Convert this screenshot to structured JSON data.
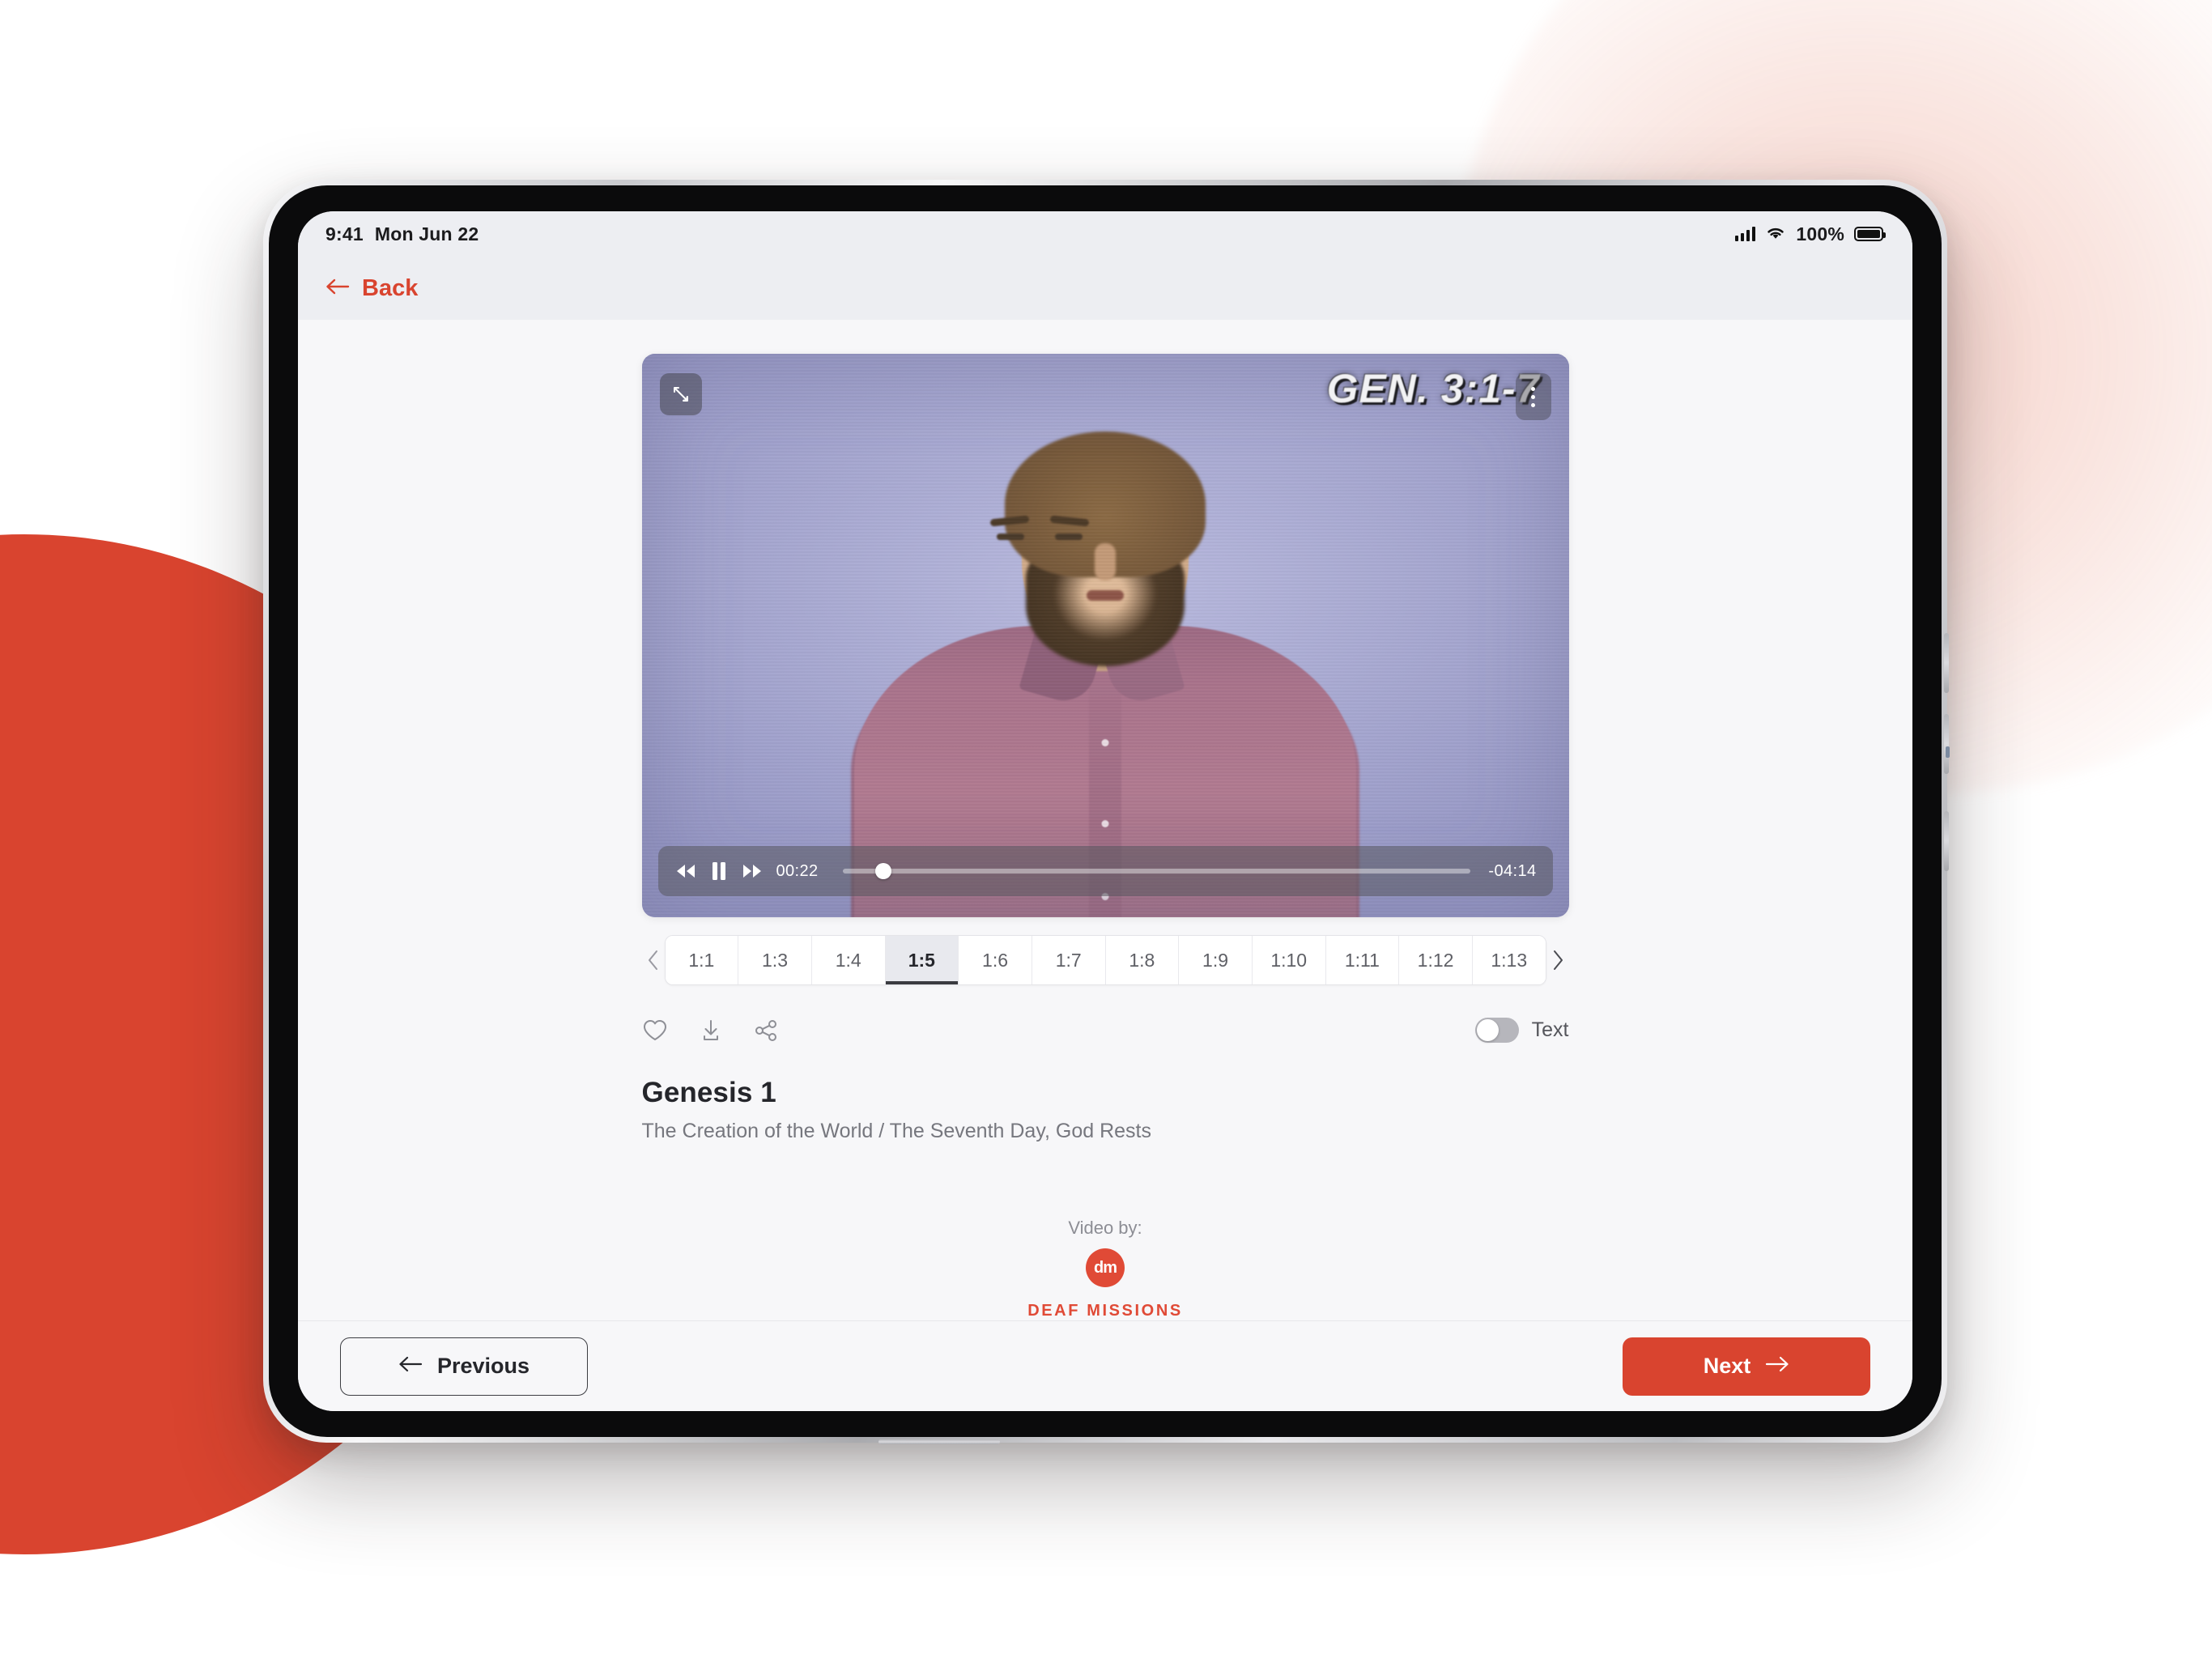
{
  "theme": {
    "accent_red": "#d9442f",
    "header_bg": "#edeef2",
    "content_bg": "#f7f7f9"
  },
  "status_bar": {
    "time": "9:41",
    "date": "Mon Jun 22",
    "battery_percent": "100%",
    "signal_icon": "cellular-signal-icon",
    "wifi_icon": "wifi-icon",
    "battery_icon": "battery-full-icon"
  },
  "header": {
    "back_label": "Back",
    "back_icon": "arrow-left-icon"
  },
  "video": {
    "burned_in_reference": "GEN. 3:1-7",
    "expand_icon": "expand-fullscreen-icon",
    "more_icon": "more-vertical-icon",
    "controls": {
      "rewind_icon": "rewind-icon",
      "pause_icon": "pause-icon",
      "forward_icon": "fast-forward-icon",
      "current_time": "00:22",
      "remaining_time": "-04:14",
      "progress_percent": 6.5
    }
  },
  "verses": {
    "prev_icon": "chevron-left-icon",
    "next_icon": "chevron-right-icon",
    "active": "1:5",
    "items": [
      {
        "label": "1:1"
      },
      {
        "label": "1:3"
      },
      {
        "label": "1:4"
      },
      {
        "label": "1:5"
      },
      {
        "label": "1:6"
      },
      {
        "label": "1:7"
      },
      {
        "label": "1:8"
      },
      {
        "label": "1:9"
      },
      {
        "label": "1:10"
      },
      {
        "label": "1:11"
      },
      {
        "label": "1:12"
      },
      {
        "label": "1:13"
      }
    ]
  },
  "actions": {
    "favorite_icon": "heart-icon",
    "download_icon": "download-icon",
    "share_icon": "share-icon",
    "text_toggle_label": "Text",
    "text_toggle_on": false
  },
  "passage": {
    "title": "Genesis 1",
    "subtitle": "The Creation of the World / The Seventh Day, God Rests"
  },
  "attribution": {
    "lead": "Video by:",
    "logo_mark": "dm",
    "provider": "DEAF MISSIONS"
  },
  "footer": {
    "previous_label": "Previous",
    "previous_icon": "arrow-left-icon",
    "next_label": "Next",
    "next_icon": "arrow-right-icon"
  }
}
